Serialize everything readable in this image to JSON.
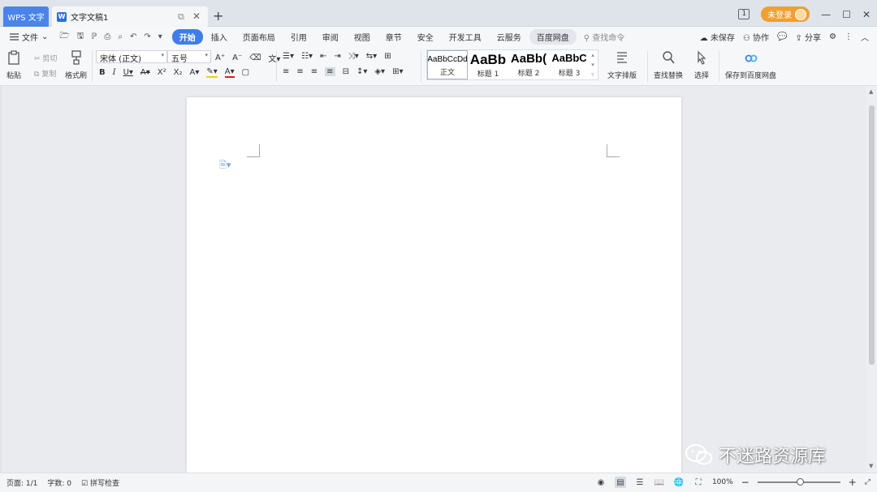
{
  "titlebar": {
    "app_tab": "WPS 文字",
    "doc_tab": "文字文稿1",
    "doc_icon_letter": "W",
    "tab_count": "1",
    "login": "未登录",
    "new_tab": "+",
    "float_icon": "⧉",
    "close_icon": "✕",
    "minimize_icon": "—",
    "maximize_icon": "☐",
    "window_close_icon": "✕"
  },
  "menubar": {
    "file": "文件",
    "tabs": [
      "开始",
      "插入",
      "页面布局",
      "引用",
      "审阅",
      "视图",
      "章节",
      "安全",
      "开发工具",
      "云服务",
      "百度网盘"
    ],
    "active_tab": "开始",
    "search": "查找命令",
    "unsaved": "未保存",
    "collaborate": "协作",
    "share": "分享"
  },
  "ribbon": {
    "paste": "粘贴",
    "cut": "剪切",
    "copy": "复制",
    "format_painter": "格式刷",
    "font_name": "宋体 (正文)",
    "font_size": "五号",
    "styles": [
      {
        "sample": "AaBbCcDd",
        "label": "正文"
      },
      {
        "sample": "AaBb",
        "label": "标题 1"
      },
      {
        "sample": "AaBb(",
        "label": "标题 2"
      },
      {
        "sample": "AaBbC",
        "label": "标题 3"
      }
    ],
    "text_layout": "文字排版",
    "find_replace": "查找替换",
    "select": "选择",
    "save_baidu": "保存到百度网盘"
  },
  "statusbar": {
    "page": "页面: 1/1",
    "word_count": "字数: 0",
    "spell_check": "拼写检查",
    "zoom": "100%"
  },
  "watermark": {
    "text": "不迷路资源库"
  },
  "colors": {
    "accent": "#3f7ee8",
    "app_tab_bg": "#4a84e8",
    "login_bg": "#f0a030"
  }
}
